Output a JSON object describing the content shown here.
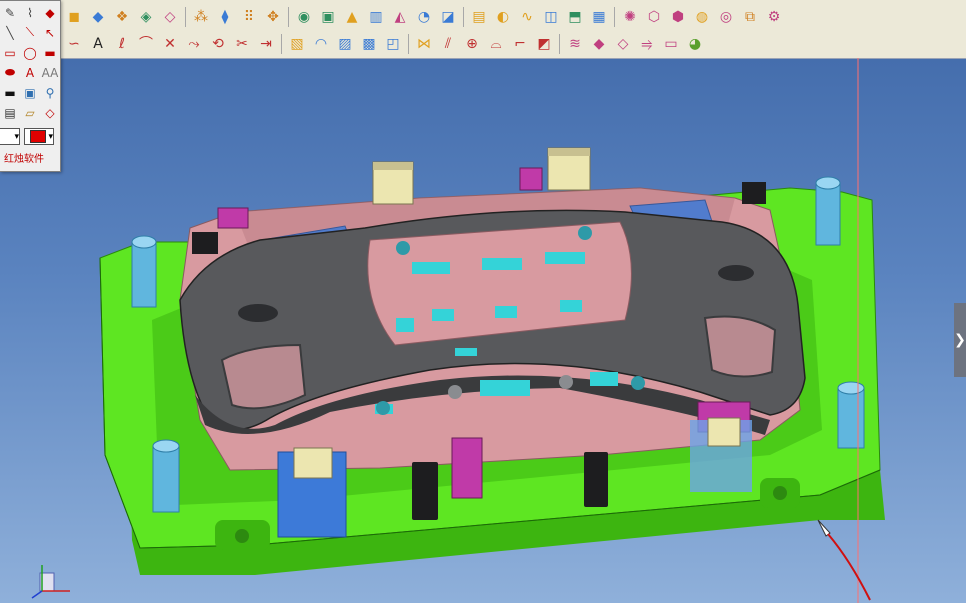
{
  "toolbar": {
    "row1": [
      {
        "icon": "part-icon",
        "glyph": "◼",
        "color": "#e0a020"
      },
      {
        "icon": "solid-box-icon",
        "glyph": "◆",
        "color": "#3a7bd5"
      },
      {
        "icon": "assembly-icon",
        "glyph": "❖",
        "color": "#d08020"
      },
      {
        "icon": "surface-icon",
        "glyph": "◈",
        "color": "#2f8f5f"
      },
      {
        "icon": "shell-icon",
        "glyph": "◇",
        "color": "#c04080"
      },
      {
        "icon": "sep"
      },
      {
        "icon": "pattern-icon",
        "glyph": "⁂",
        "color": "#d08020"
      },
      {
        "icon": "mirror-icon",
        "glyph": "⧫",
        "color": "#3a7bd5"
      },
      {
        "icon": "array-icon",
        "glyph": "⠿",
        "color": "#d08020"
      },
      {
        "icon": "move-icon",
        "glyph": "✥",
        "color": "#d08020"
      },
      {
        "icon": "sep"
      },
      {
        "icon": "hole-icon",
        "glyph": "◉",
        "color": "#2f8f5f"
      },
      {
        "icon": "pocket-icon",
        "glyph": "▣",
        "color": "#2f8f5f"
      },
      {
        "icon": "boss-icon",
        "glyph": "▲",
        "color": "#e0a020"
      },
      {
        "icon": "rib-icon",
        "glyph": "▥",
        "color": "#3a7bd5"
      },
      {
        "icon": "draft-icon",
        "glyph": "◭",
        "color": "#c04080"
      },
      {
        "icon": "fillet-icon",
        "glyph": "◔",
        "color": "#3a7bd5"
      },
      {
        "icon": "chamfer-icon",
        "glyph": "◪",
        "color": "#3a7bd5"
      },
      {
        "icon": "sep"
      },
      {
        "icon": "extrude-icon",
        "glyph": "▤",
        "color": "#e0a020"
      },
      {
        "icon": "revolve-icon",
        "glyph": "◐",
        "color": "#e0a020"
      },
      {
        "icon": "sweep-icon",
        "glyph": "∿",
        "color": "#e0a020"
      },
      {
        "icon": "loft-icon",
        "glyph": "◫",
        "color": "#3a7bd5"
      },
      {
        "icon": "offset-icon",
        "glyph": "⬒",
        "color": "#2f8f5f"
      },
      {
        "icon": "thicken-icon",
        "glyph": "▦",
        "color": "#3a7bd5"
      },
      {
        "icon": "sep"
      },
      {
        "icon": "analysis-icon",
        "glyph": "✺",
        "color": "#c04080"
      },
      {
        "icon": "measure-icon",
        "glyph": "⬡",
        "color": "#c04080"
      },
      {
        "icon": "section-icon",
        "glyph": "⬢",
        "color": "#c04080"
      },
      {
        "icon": "render-icon",
        "glyph": "◍",
        "color": "#e0a020"
      },
      {
        "icon": "material-icon",
        "glyph": "◎",
        "color": "#c04080"
      },
      {
        "icon": "layer-icon",
        "glyph": "⧉",
        "color": "#d08020"
      },
      {
        "icon": "settings-icon",
        "glyph": "⚙",
        "color": "#c04080"
      }
    ],
    "row2": [
      {
        "icon": "spline-icon",
        "glyph": "∽",
        "color": "#c03030"
      },
      {
        "icon": "text-icon",
        "glyph": "A",
        "color": "#222222"
      },
      {
        "icon": "curve-icon",
        "glyph": "ℓ",
        "color": "#c03030"
      },
      {
        "icon": "arc-icon",
        "glyph": "⌒",
        "color": "#c03030"
      },
      {
        "icon": "intersect-icon",
        "glyph": "✕",
        "color": "#c03030"
      },
      {
        "icon": "project-icon",
        "glyph": "⤳",
        "color": "#c03030"
      },
      {
        "icon": "wrap-icon",
        "glyph": "⟲",
        "color": "#c03030"
      },
      {
        "icon": "trim-icon",
        "glyph": "✂",
        "color": "#c03030"
      },
      {
        "icon": "extend-icon",
        "glyph": "⇥",
        "color": "#c03030"
      },
      {
        "icon": "sep"
      },
      {
        "icon": "patch-icon",
        "glyph": "▧",
        "color": "#e0a020"
      },
      {
        "icon": "blend-icon",
        "glyph": "◠",
        "color": "#3a7bd5"
      },
      {
        "icon": "ruled-surface-icon",
        "glyph": "▨",
        "color": "#3a7bd5"
      },
      {
        "icon": "mesh-surface-icon",
        "glyph": "▩",
        "color": "#3a7bd5"
      },
      {
        "icon": "boundary-surface-icon",
        "glyph": "◰",
        "color": "#3a7bd5"
      },
      {
        "icon": "sep"
      },
      {
        "icon": "knit-icon",
        "glyph": "⋈",
        "color": "#e0a020"
      },
      {
        "icon": "split-icon",
        "glyph": "⫽",
        "color": "#c03030"
      },
      {
        "icon": "join-icon",
        "glyph": "⊕",
        "color": "#c03030"
      },
      {
        "icon": "bridge-icon",
        "glyph": "⌓",
        "color": "#c03030"
      },
      {
        "icon": "flange-icon",
        "glyph": "⌐",
        "color": "#c03030"
      },
      {
        "icon": "fill-icon",
        "glyph": "◩",
        "color": "#c03030"
      },
      {
        "icon": "sep"
      },
      {
        "icon": "parting-line-icon",
        "glyph": "≋",
        "color": "#c04080"
      },
      {
        "icon": "core-icon",
        "glyph": "◆",
        "color": "#c04080"
      },
      {
        "icon": "cavity-icon",
        "glyph": "◇",
        "color": "#c04080"
      },
      {
        "icon": "runner-icon",
        "glyph": "⥤",
        "color": "#c04080"
      },
      {
        "icon": "mold-base-icon",
        "glyph": "▭",
        "color": "#c04080"
      },
      {
        "icon": "color-icon",
        "glyph": "◕",
        "color": "#5aa02c"
      }
    ]
  },
  "palette": {
    "tools": [
      {
        "icon": "pencil-icon",
        "glyph": "✎",
        "color": "#444444"
      },
      {
        "icon": "eyedropper-icon",
        "glyph": "⌇",
        "color": "#444444"
      },
      {
        "icon": "fill-bucket-icon",
        "glyph": "◆",
        "color": "#c00000"
      },
      {
        "icon": "line-tool-icon",
        "glyph": "╲",
        "color": "#444444"
      },
      {
        "icon": "polyline-tool-icon",
        "glyph": "⟍",
        "color": "#c00000"
      },
      {
        "icon": "arrow-tool-icon",
        "glyph": "↖",
        "color": "#c00000"
      },
      {
        "icon": "rectangle-tool-icon",
        "glyph": "▭",
        "color": "#c00000"
      },
      {
        "icon": "ellipse-tool-icon",
        "glyph": "◯",
        "color": "#c00000"
      },
      {
        "icon": "filled-rect-tool-icon",
        "glyph": "▬",
        "color": "#c00000"
      },
      {
        "icon": "filled-ellipse-tool-icon",
        "glyph": "⬬",
        "color": "#c00000"
      },
      {
        "icon": "text-tool-icon",
        "glyph": "A",
        "color": "#c00000"
      },
      {
        "icon": "font-size-tool-icon",
        "glyph": "AA",
        "color": "#777777"
      },
      {
        "icon": "highlight-tool-icon",
        "glyph": "▬",
        "color": "#111111"
      },
      {
        "icon": "image-tool-icon",
        "glyph": "▣",
        "color": "#2f6fb0"
      },
      {
        "icon": "zoom-tool-icon",
        "glyph": "⚲",
        "color": "#2f6fb0"
      },
      {
        "icon": "save-tool-icon",
        "glyph": "▤",
        "color": "#333333"
      },
      {
        "icon": "open-folder-tool-icon",
        "glyph": "▱",
        "color": "#b08020"
      },
      {
        "icon": "eraser-tool-icon",
        "glyph": "◇",
        "color": "#c00000"
      }
    ],
    "line_width_value": "",
    "color_value": "#e00000",
    "brand_label": "红烛软件"
  },
  "viewport": {
    "colors": {
      "mold_base": "#5ee622",
      "mold_base_dark": "#3db510",
      "insert_pink": "#d89aa0",
      "insert_pink_dark": "#b87a80",
      "bumper_gray": "#58595c",
      "bumper_dark": "#3a3b3d",
      "slider_blue": "#3d7ad8",
      "cyan_pad": "#34d3d8",
      "pillar": "#60b6de",
      "magenta_block": "#c03aa8",
      "cream_block": "#ece6b0"
    }
  },
  "side_tab_glyph": "❯"
}
